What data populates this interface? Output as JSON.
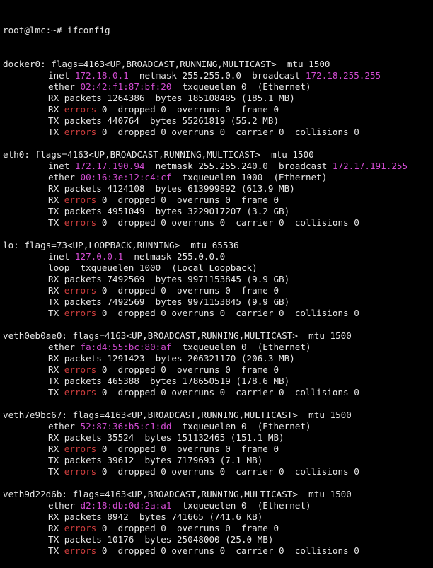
{
  "prompt": "root@lmc:~# ifconfig",
  "colors": {
    "background": "#000000",
    "text": "#e6e6e6",
    "address": "#d34cd3",
    "errors_keyword": "#d03e3e"
  },
  "interfaces": [
    {
      "header": "docker0: flags=4163<UP,BROADCAST,RUNNING,MULTICAST>  mtu 1500",
      "lines": [
        [
          {
            "t": "inet "
          },
          {
            "t": "172.18.0.1",
            "c": "addr"
          },
          {
            "t": "  netmask 255.255.0.0  broadcast "
          },
          {
            "t": "172.18.255.255",
            "c": "addr"
          }
        ],
        [
          {
            "t": "ether "
          },
          {
            "t": "02:42:f1:87:bf:20",
            "c": "addr"
          },
          {
            "t": "  txqueuelen 0  (Ethernet)"
          }
        ],
        [
          {
            "t": "RX packets 1264386  bytes 185108485 (185.1 MB)"
          }
        ],
        [
          {
            "t": "RX "
          },
          {
            "t": "errors",
            "c": "err"
          },
          {
            "t": " 0  dropped 0  overruns 0  frame 0"
          }
        ],
        [
          {
            "t": "TX packets 440764  bytes 55261819 (55.2 MB)"
          }
        ],
        [
          {
            "t": "TX "
          },
          {
            "t": "errors",
            "c": "err"
          },
          {
            "t": " 0  dropped 0 overruns 0  carrier 0  collisions 0"
          }
        ]
      ]
    },
    {
      "header": "eth0: flags=4163<UP,BROADCAST,RUNNING,MULTICAST>  mtu 1500",
      "lines": [
        [
          {
            "t": "inet "
          },
          {
            "t": "172.17.190.94",
            "c": "addr"
          },
          {
            "t": "  netmask 255.255.240.0  broadcast "
          },
          {
            "t": "172.17.191.255",
            "c": "addr"
          }
        ],
        [
          {
            "t": "ether "
          },
          {
            "t": "00:16:3e:12:c4:cf",
            "c": "addr"
          },
          {
            "t": "  txqueuelen 1000  (Ethernet)"
          }
        ],
        [
          {
            "t": "RX packets 4124108  bytes 613999892 (613.9 MB)"
          }
        ],
        [
          {
            "t": "RX "
          },
          {
            "t": "errors",
            "c": "err"
          },
          {
            "t": " 0  dropped 0  overruns 0  frame 0"
          }
        ],
        [
          {
            "t": "TX packets 4951049  bytes 3229017207 (3.2 GB)"
          }
        ],
        [
          {
            "t": "TX "
          },
          {
            "t": "errors",
            "c": "err"
          },
          {
            "t": " 0  dropped 0 overruns 0  carrier 0  collisions 0"
          }
        ]
      ]
    },
    {
      "header": "lo: flags=73<UP,LOOPBACK,RUNNING>  mtu 65536",
      "lines": [
        [
          {
            "t": "inet "
          },
          {
            "t": "127.0.0.1",
            "c": "addr"
          },
          {
            "t": "  netmask 255.0.0.0"
          }
        ],
        [
          {
            "t": "loop  txqueuelen 1000  (Local Loopback)"
          }
        ],
        [
          {
            "t": "RX packets 7492569  bytes 9971153845 (9.9 GB)"
          }
        ],
        [
          {
            "t": "RX "
          },
          {
            "t": "errors",
            "c": "err"
          },
          {
            "t": " 0  dropped 0  overruns 0  frame 0"
          }
        ],
        [
          {
            "t": "TX packets 7492569  bytes 9971153845 (9.9 GB)"
          }
        ],
        [
          {
            "t": "TX "
          },
          {
            "t": "errors",
            "c": "err"
          },
          {
            "t": " 0  dropped 0 overruns 0  carrier 0  collisions 0"
          }
        ]
      ]
    },
    {
      "header": "veth0eb0ae0: flags=4163<UP,BROADCAST,RUNNING,MULTICAST>  mtu 1500",
      "lines": [
        [
          {
            "t": "ether "
          },
          {
            "t": "fa:d4:55:bc:80:af",
            "c": "addr"
          },
          {
            "t": "  txqueuelen 0  (Ethernet)"
          }
        ],
        [
          {
            "t": "RX packets 1291423  bytes 206321170 (206.3 MB)"
          }
        ],
        [
          {
            "t": "RX "
          },
          {
            "t": "errors",
            "c": "err"
          },
          {
            "t": " 0  dropped 0  overruns 0  frame 0"
          }
        ],
        [
          {
            "t": "TX packets 465388  bytes 178650519 (178.6 MB)"
          }
        ],
        [
          {
            "t": "TX "
          },
          {
            "t": "errors",
            "c": "err"
          },
          {
            "t": " 0  dropped 0 overruns 0  carrier 0  collisions 0"
          }
        ]
      ]
    },
    {
      "header": "veth7e9bc67: flags=4163<UP,BROADCAST,RUNNING,MULTICAST>  mtu 1500",
      "lines": [
        [
          {
            "t": "ether "
          },
          {
            "t": "52:87:36:b5:c1:dd",
            "c": "addr"
          },
          {
            "t": "  txqueuelen 0  (Ethernet)"
          }
        ],
        [
          {
            "t": "RX packets 35524  bytes 151132465 (151.1 MB)"
          }
        ],
        [
          {
            "t": "RX "
          },
          {
            "t": "errors",
            "c": "err"
          },
          {
            "t": " 0  dropped 0  overruns 0  frame 0"
          }
        ],
        [
          {
            "t": "TX packets 39612  bytes 7179693 (7.1 MB)"
          }
        ],
        [
          {
            "t": "TX "
          },
          {
            "t": "errors",
            "c": "err"
          },
          {
            "t": " 0  dropped 0 overruns 0  carrier 0  collisions 0"
          }
        ]
      ]
    },
    {
      "header": "veth9d22d6b: flags=4163<UP,BROADCAST,RUNNING,MULTICAST>  mtu 1500",
      "lines": [
        [
          {
            "t": "ether "
          },
          {
            "t": "d2:18:db:0d:2a:a1",
            "c": "addr"
          },
          {
            "t": "  txqueuelen 0  (Ethernet)"
          }
        ],
        [
          {
            "t": "RX packets 8942  bytes 741665 (741.6 KB)"
          }
        ],
        [
          {
            "t": "RX "
          },
          {
            "t": "errors",
            "c": "err"
          },
          {
            "t": " 0  dropped 0  overruns 0  frame 0"
          }
        ],
        [
          {
            "t": "TX packets 10176  bytes 25048000 (25.0 MB)"
          }
        ],
        [
          {
            "t": "TX "
          },
          {
            "t": "errors",
            "c": "err"
          },
          {
            "t": " 0  dropped 0 overruns 0  carrier 0  collisions 0"
          }
        ]
      ]
    }
  ]
}
